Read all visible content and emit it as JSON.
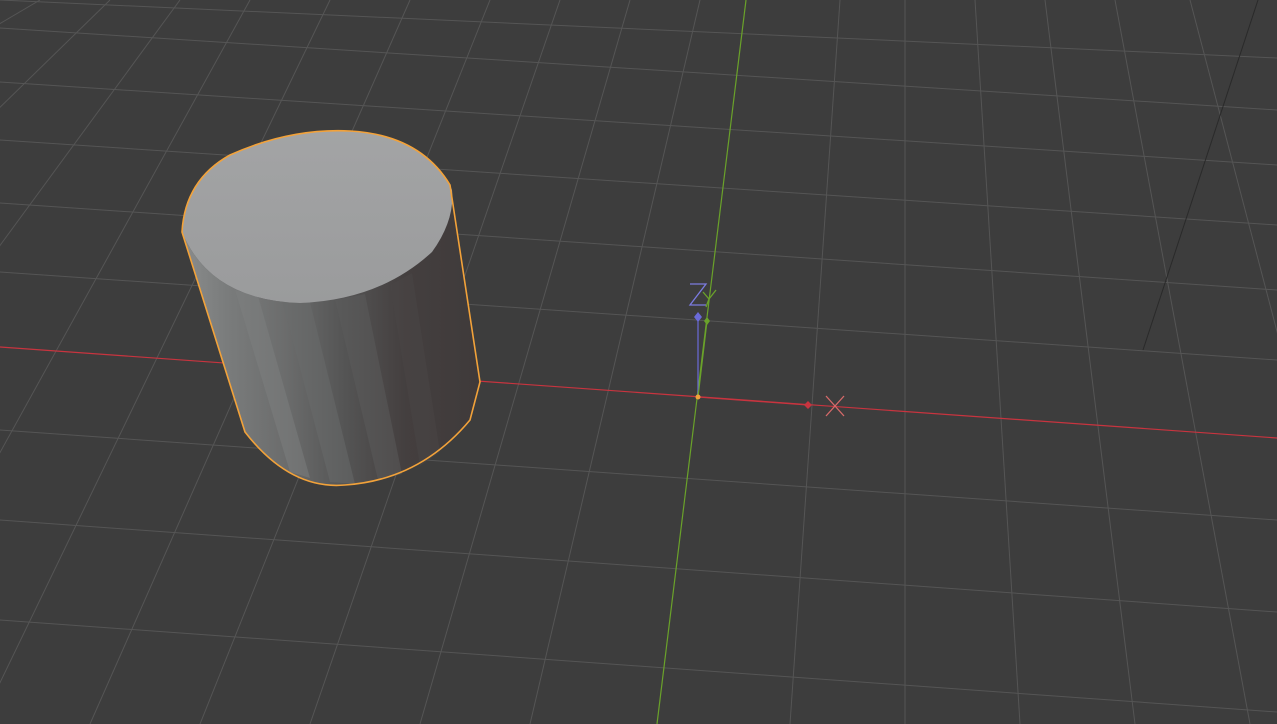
{
  "viewport": {
    "background": "#3d3d3d",
    "grid_color": "#5a5a5a",
    "x_axis_color": "#c8343f",
    "y_axis_color": "#6aa22a",
    "z_axis_color": "#6a6ad8",
    "selection_color": "#f2a23a"
  },
  "gizmo": {
    "z_label": "Z",
    "y_label": "Y",
    "x_label": "X"
  },
  "objects": [
    {
      "name": "cylinder",
      "selected": true
    }
  ],
  "icons": [
    "empty-axes-icon",
    "camera-edge"
  ]
}
